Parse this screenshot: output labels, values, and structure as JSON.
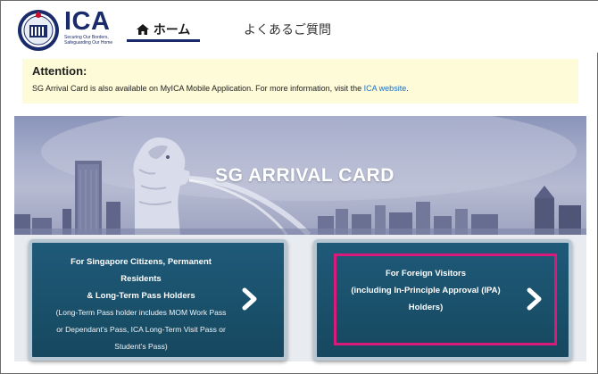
{
  "header": {
    "logo_title": "ICA",
    "logo_tagline": "Securing Our Borders, Safeguarding Our Home",
    "nav_home": "ホーム",
    "nav_faq": "よくあるご質問"
  },
  "attention": {
    "title": "Attention:",
    "body": "SG Arrival Card is also available on MyICA Mobile Application. For more information, visit the",
    "link": "ICA website",
    "suffix": "."
  },
  "hero": {
    "title": "SG ARRIVAL CARD"
  },
  "cards": {
    "residents": {
      "line1": "For Singapore Citizens, Permanent",
      "line2": "Residents",
      "line3": "& Long-Term Pass Holders",
      "line4": "(Long-Term Pass holder includes MOM Work Pass",
      "line5": "or Dependant’s Pass, ICA Long-Term Visit Pass or",
      "line6": "Student’s Pass)"
    },
    "visitors": {
      "line1": "For Foreign Visitors",
      "line2": "(including In-Principle Approval (IPA)",
      "line3": "Holders)"
    }
  },
  "colors": {
    "brand_navy": "#1a2b6b",
    "card_bg": "#1f5a79",
    "attention_bg": "#fdfbd8",
    "link": "#1a6fc9",
    "highlight": "#d81b7a"
  },
  "icons": [
    "ica-emblem-icon",
    "home-icon",
    "chevron-right-icon"
  ]
}
